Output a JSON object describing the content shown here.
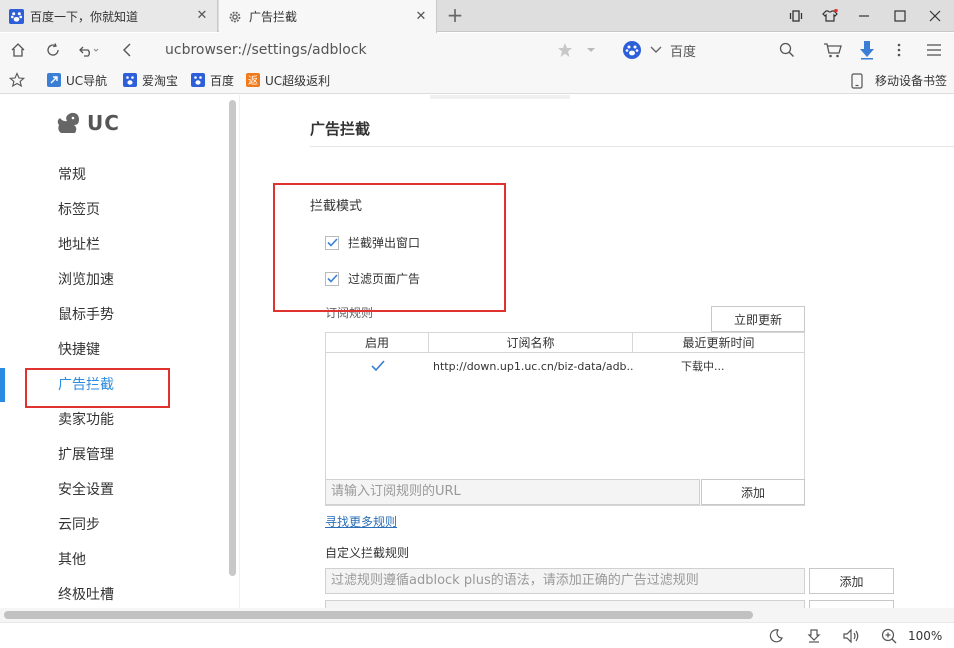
{
  "tabs": [
    {
      "title": "百度一下，你就知道",
      "icon": "baidu-paw-icon",
      "active": false
    },
    {
      "title": "广告拦截",
      "icon": "gear-icon",
      "active": true
    }
  ],
  "address": {
    "url": "ucbrowser://settings/adblock"
  },
  "search": {
    "engine": "百度"
  },
  "bookmarks": {
    "items": [
      {
        "label": "UC导航",
        "icon": "uc-nav-icon"
      },
      {
        "label": "爱淘宝",
        "icon": "baidu-paw-icon"
      },
      {
        "label": "百度",
        "icon": "baidu-paw-icon"
      },
      {
        "label": "UC超级返利",
        "icon": "fanli-icon"
      }
    ],
    "mobile": "移动设备书签"
  },
  "sidebar": {
    "logo": "UC",
    "items": [
      "常规",
      "标签页",
      "地址栏",
      "浏览加速",
      "鼠标手势",
      "快捷键",
      "广告拦截",
      "卖家功能",
      "扩展管理",
      "安全设置",
      "云同步",
      "其他",
      "终极吐槽"
    ],
    "active_index": 6
  },
  "main": {
    "title": "广告拦截",
    "mode_label": "拦截模式",
    "options": [
      {
        "label": "拦截弹出窗口",
        "checked": true
      },
      {
        "label": "过滤页面广告",
        "checked": true
      }
    ],
    "subscription": {
      "label": "订阅规则",
      "update_button": "立即更新",
      "columns": [
        "启用",
        "订阅名称",
        "最近更新时间"
      ],
      "rows": [
        {
          "enabled": true,
          "name": "http://down.up1.uc.cn/biz-data/adb...",
          "updated": "下载中..."
        }
      ],
      "url_placeholder": "请输入订阅规则的URL",
      "add_button": "添加",
      "more_link": "寻找更多规则"
    },
    "custom": {
      "label": "自定义拦截规则",
      "placeholder": "过滤规则遵循adblock plus的语法，请添加正确的广告过滤规则",
      "add_button": "添加"
    }
  },
  "status": {
    "zoom": "100%"
  },
  "colors": {
    "accent": "#2a8be0",
    "highlight": "#e0322f"
  }
}
